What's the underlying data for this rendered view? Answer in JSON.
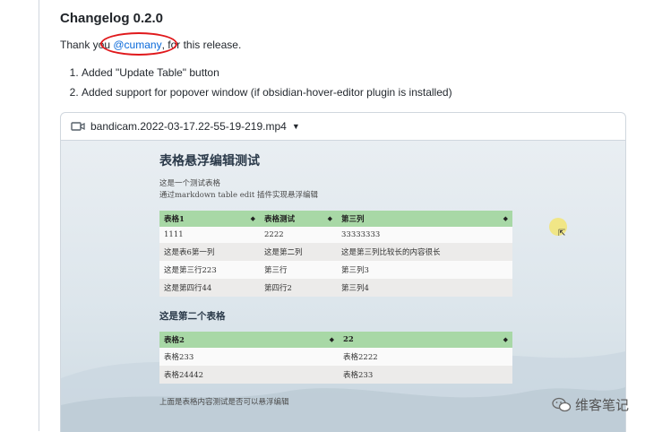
{
  "release": {
    "title": "Changelog 0.2.0",
    "thanks_prefix": "Thank you ",
    "mention": "@cumany",
    "thanks_suffix": ", for this release.",
    "items": [
      "Added \"Update Table\" button",
      "Added support for popover window (if obsidian-hover-editor plugin is installed)"
    ]
  },
  "video": {
    "filename": "bandicam.2022-03-17.22-55-19-219.mp4",
    "icon": "video-camera-icon",
    "doc": {
      "title": "表格悬浮编辑测试",
      "line1": "这是一个测试表格",
      "line2": "通过markdown table edit 插件实现悬浮编辑",
      "table1": {
        "headers": [
          "表格1",
          "表格测试",
          "第三列"
        ],
        "rows": [
          [
            "1111",
            "2222",
            "33333333"
          ],
          [
            "这是表6第一列",
            "这是第二列",
            "这是第三列比较长的内容很长"
          ],
          [
            "这是第三行223",
            "第三行",
            "第三列3"
          ],
          [
            "这是第四行44",
            "第四行2",
            "第三列4"
          ]
        ]
      },
      "subtitle": "这是第二个表格",
      "table2": {
        "headers": [
          "表格2",
          "22"
        ],
        "rows": [
          [
            "表格233",
            "表格2222"
          ],
          [
            "表格24442",
            "表格233"
          ]
        ]
      },
      "footer": "上面是表格内容测试是否可以悬浮编辑"
    }
  },
  "watermark": "维客笔记"
}
